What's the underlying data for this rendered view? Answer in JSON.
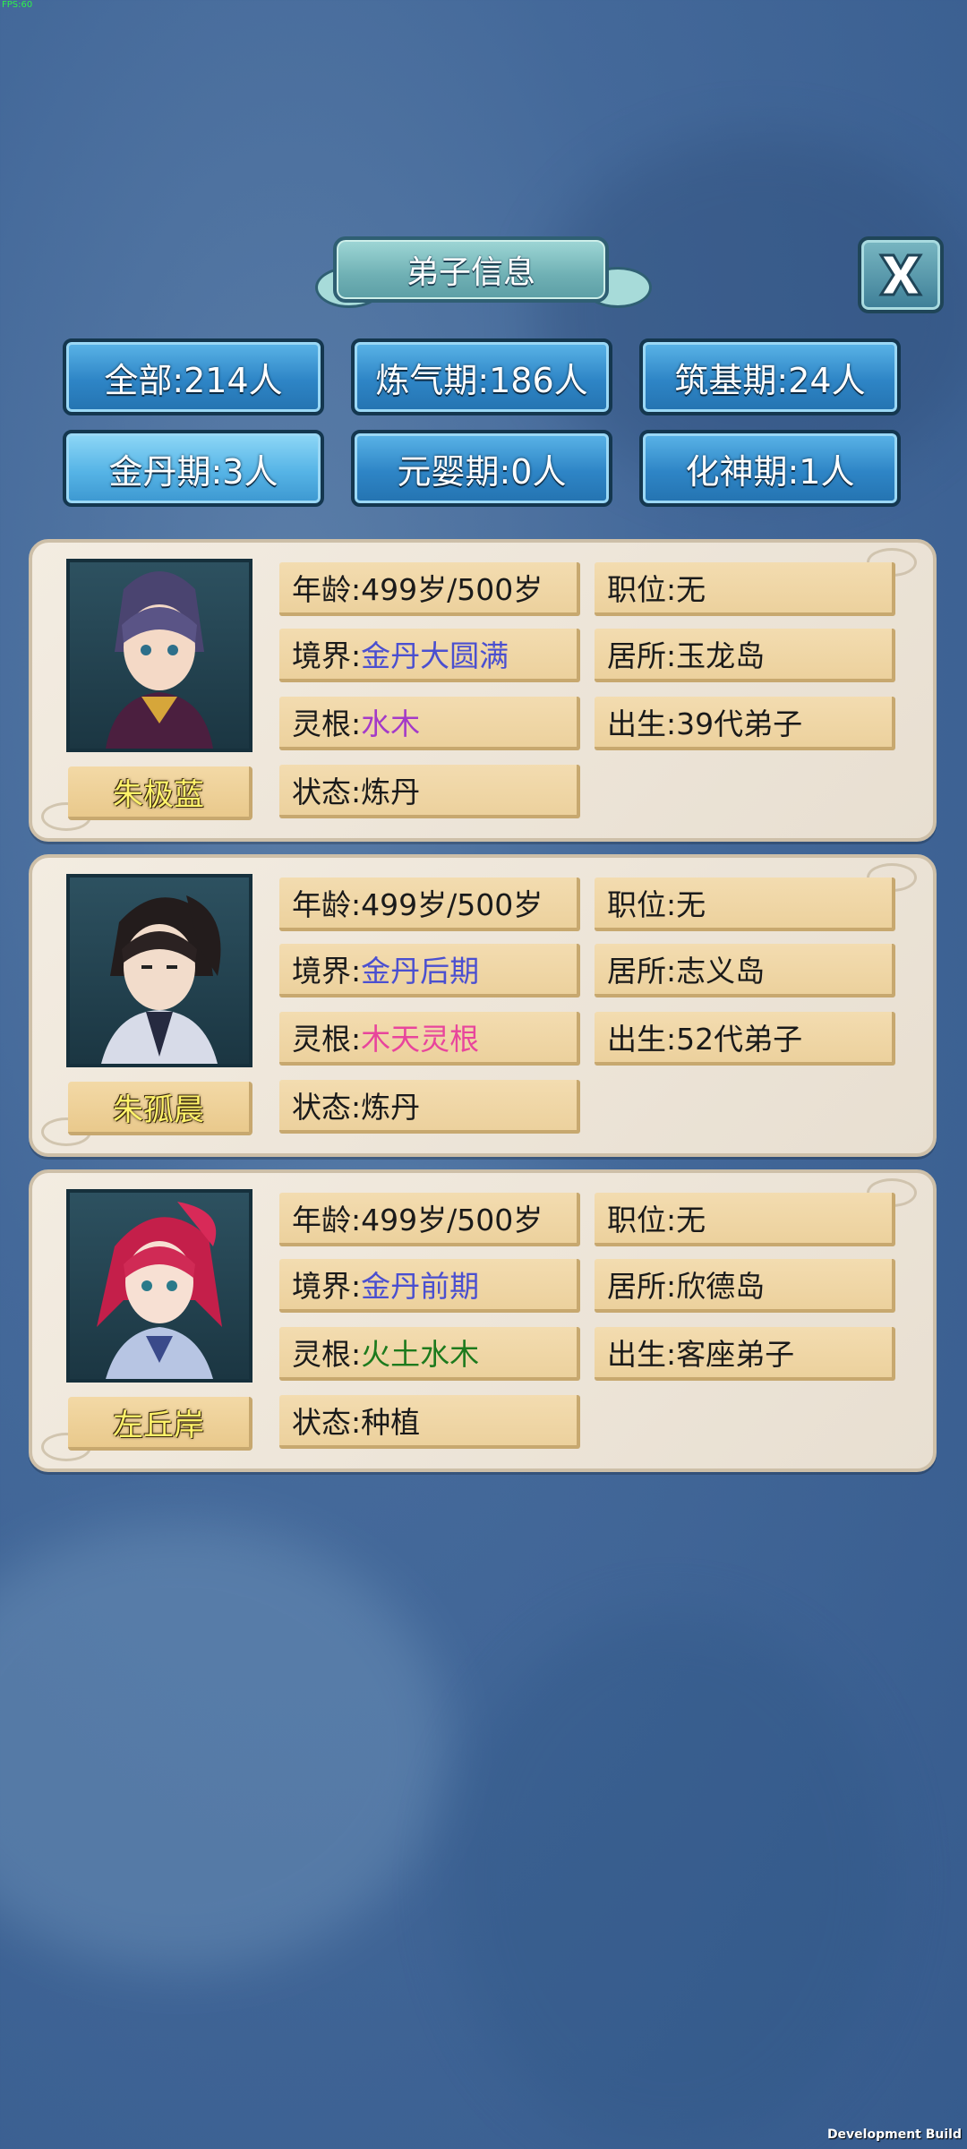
{
  "debug": {
    "fps": "FPS:60",
    "build_label": "Development Build"
  },
  "title": "弟子信息",
  "close_label": "X",
  "filters": [
    {
      "label": "全部:214人"
    },
    {
      "label": "炼气期:186人"
    },
    {
      "label": "筑基期:24人"
    },
    {
      "label": "金丹期:3人"
    },
    {
      "label": "元婴期:0人"
    },
    {
      "label": "化神期:1人"
    }
  ],
  "labels": {
    "age": "年龄:",
    "position": "职位:",
    "realm": "境界:",
    "residence": "居所:",
    "root": "灵根:",
    "birth": "出生:",
    "status": "状态:"
  },
  "disciples": [
    {
      "name": "朱极蓝",
      "age": "499岁/500岁",
      "position": "无",
      "realm": "金丹大圆满",
      "residence": "玉龙岛",
      "root": "水木",
      "birth": "39代弟子",
      "status": "炼丹",
      "realm_color": "#4a4fd0",
      "root_color": "#a43ac8"
    },
    {
      "name": "朱孤晨",
      "age": "499岁/500岁",
      "position": "无",
      "realm": "金丹后期",
      "residence": "志义岛",
      "root": "木天灵根",
      "birth": "52代弟子",
      "status": "炼丹",
      "realm_color": "#4a4fd0",
      "root_color": "#e8459c"
    },
    {
      "name": "左丘岸",
      "age": "499岁/500岁",
      "position": "无",
      "realm": "金丹前期",
      "residence": "欣德岛",
      "root": "火土水木",
      "birth": "客座弟子",
      "status": "种植",
      "realm_color": "#4a4fd0",
      "root_color": "#1d7a1d"
    }
  ]
}
